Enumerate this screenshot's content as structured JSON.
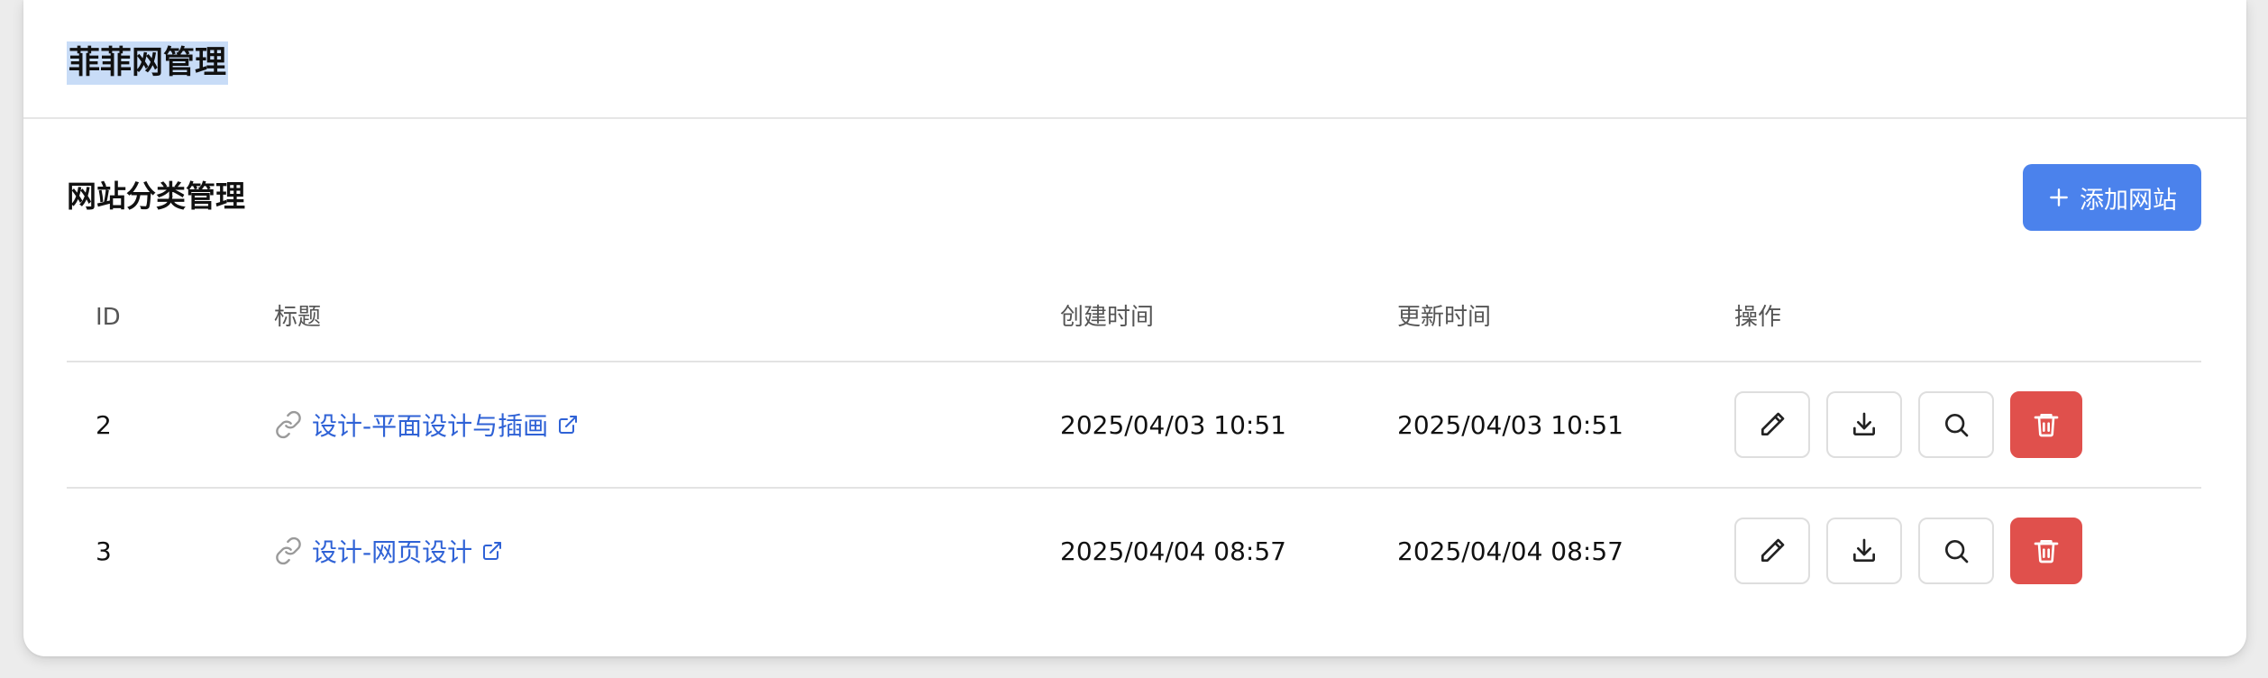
{
  "header": {
    "title": "菲菲网管理"
  },
  "section": {
    "title": "网站分类管理",
    "add_button_label": "添加网站"
  },
  "table": {
    "columns": [
      "ID",
      "标题",
      "创建时间",
      "更新时间",
      "操作"
    ],
    "rows": [
      {
        "id": "2",
        "title": "设计-平面设计与插画",
        "created": "2025/04/03 10:51",
        "updated": "2025/04/03 10:51"
      },
      {
        "id": "3",
        "title": "设计-网页设计",
        "created": "2025/04/04 08:57",
        "updated": "2025/04/04 08:57"
      }
    ]
  },
  "icons": {
    "add": "plus-icon",
    "title_prefix": "link-icon",
    "title_suffix": "external-link-icon",
    "actions": [
      "edit-icon",
      "download-icon",
      "search-icon",
      "trash-icon"
    ]
  },
  "colors": {
    "accent": "#4b82ec",
    "link": "#2f62d6",
    "danger": "#e0504c",
    "title_highlight": "#c8dcf7"
  }
}
